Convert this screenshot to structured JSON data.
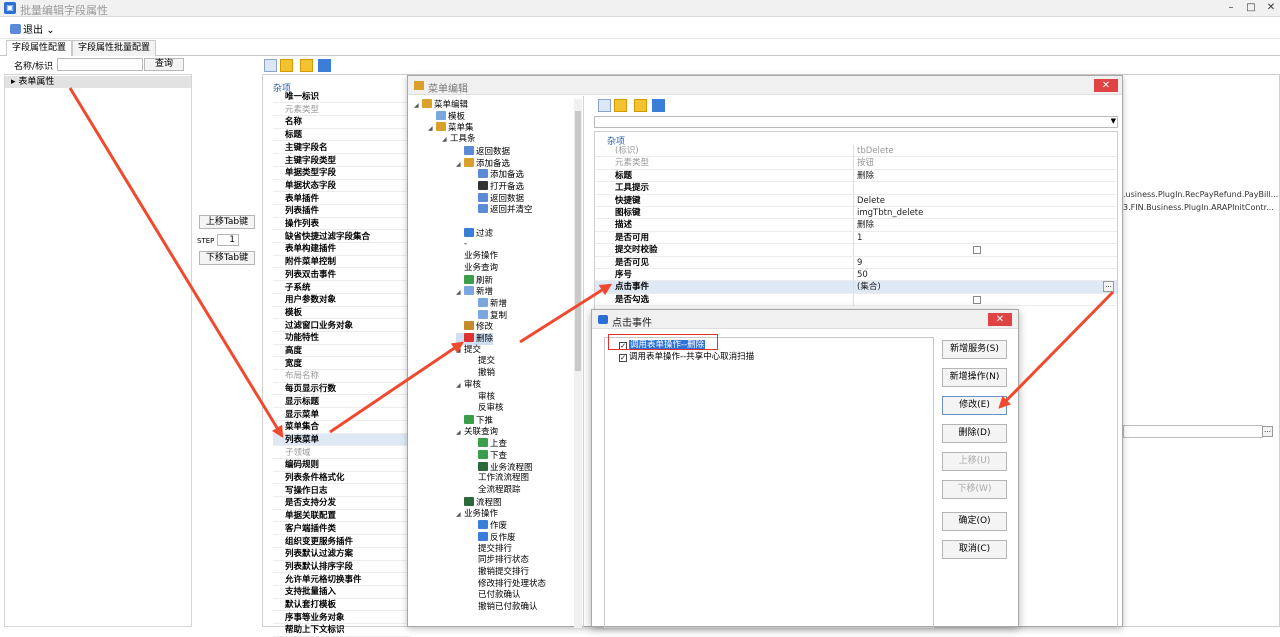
{
  "window": {
    "title": "批量编辑字段属性",
    "min": "–",
    "max": "□",
    "close": "✕"
  },
  "toolbar": {
    "exit": "退出",
    "dropdown": "⌄"
  },
  "tabs": [
    "字段属性配置",
    "字段属性批量配置"
  ],
  "search": {
    "label": "名称/标识",
    "value": "",
    "button": "查询"
  },
  "left_tree": {
    "root": "表单属性"
  },
  "mid_controls": {
    "up": "上移Tab键",
    "step_label": "STEP",
    "step_value": "1",
    "down": "下移Tab键"
  },
  "props": {
    "category": "杂项",
    "rows": [
      {
        "label": "唯一标识",
        "gray": false
      },
      {
        "label": "元素类型",
        "gray": true
      },
      {
        "label": "名称",
        "gray": false
      },
      {
        "label": "标题",
        "gray": false
      },
      {
        "label": "主键字段名",
        "gray": false
      },
      {
        "label": "主键字段类型",
        "gray": false
      },
      {
        "label": "单据类型字段",
        "gray": false
      },
      {
        "label": "单据状态字段",
        "gray": false
      },
      {
        "label": "表单插件",
        "gray": false
      },
      {
        "label": "列表插件",
        "gray": false
      },
      {
        "label": "操作列表",
        "gray": false
      },
      {
        "label": "缺省快捷过滤字段集合",
        "gray": false
      },
      {
        "label": "表单构建插件",
        "gray": false
      },
      {
        "label": "附件菜单控制",
        "gray": false
      },
      {
        "label": "列表双击事件",
        "gray": false
      },
      {
        "label": "子系统",
        "gray": false
      },
      {
        "label": "用户参数对象",
        "gray": false
      },
      {
        "label": "模板",
        "gray": false
      },
      {
        "label": "过滤窗口业务对象",
        "gray": false
      },
      {
        "label": "功能特性",
        "gray": false
      },
      {
        "label": "高度",
        "gray": false
      },
      {
        "label": "宽度",
        "gray": false
      },
      {
        "label": "布局名称",
        "gray": true
      },
      {
        "label": "每页显示行数",
        "gray": false
      },
      {
        "label": "显示标题",
        "gray": false
      },
      {
        "label": "显示菜单",
        "gray": false
      },
      {
        "label": "菜单集合",
        "gray": false
      },
      {
        "label": "列表菜单",
        "gray": false,
        "sel": true
      },
      {
        "label": "子领域",
        "gray": true
      },
      {
        "label": "编码规则",
        "gray": false
      },
      {
        "label": "列表条件格式化",
        "gray": false
      },
      {
        "label": "写操作日志",
        "gray": false
      },
      {
        "label": "是否支持分发",
        "gray": false
      },
      {
        "label": "单据关联配置",
        "gray": false
      },
      {
        "label": "客户端插件类",
        "gray": false
      },
      {
        "label": "组织变更服务插件",
        "gray": false
      },
      {
        "label": "列表默认过滤方案",
        "gray": false
      },
      {
        "label": "列表默认排序字段",
        "gray": false
      },
      {
        "label": "允许单元格切换事件",
        "gray": false
      },
      {
        "label": "支持批量插入",
        "gray": false
      },
      {
        "label": "默认套打模板",
        "gray": false
      },
      {
        "label": "序事等业务对象",
        "gray": false
      },
      {
        "label": "帮助上下文标识",
        "gray": false
      }
    ],
    "far_values": [
      ".usiness.PlugIn.RecPayRefund.PayBill...",
      "3.FIN.Business.PlugIn.ARAPInitContr..."
    ]
  },
  "menu_editor": {
    "title": "菜单编辑",
    "close": "✕",
    "tree": [
      {
        "text": "菜单编辑",
        "lvl": 0,
        "tri": "◢",
        "ic": "#d9a02a"
      },
      {
        "text": "模板",
        "lvl": 1,
        "tri": "",
        "ic": "#7aa7e0"
      },
      {
        "text": "菜单集",
        "lvl": 1,
        "tri": "◢",
        "ic": "#d9a02a"
      },
      {
        "text": "工具条",
        "lvl": 2,
        "tri": "◢",
        "ic": ""
      },
      {
        "text": "返回数据",
        "lvl": 3,
        "tri": "",
        "ic": "#5b8bd6"
      },
      {
        "text": "添加备选",
        "lvl": 3,
        "tri": "◢",
        "ic": "#d9a02a"
      },
      {
        "text": "添加备选",
        "lvl": 4,
        "tri": "",
        "ic": "#5b8bd6"
      },
      {
        "text": "打开备选",
        "lvl": 4,
        "tri": "",
        "ic": "#333333"
      },
      {
        "text": "返回数据",
        "lvl": 4,
        "tri": "",
        "ic": "#5b8bd6"
      },
      {
        "text": "返回并清空",
        "lvl": 4,
        "tri": "",
        "ic": "#5b8bd6"
      },
      {
        "text": "",
        "lvl": 3,
        "tri": "",
        "ic": ""
      },
      {
        "text": "过滤",
        "lvl": 3,
        "tri": "",
        "ic": "#3a7ed8"
      },
      {
        "text": "-",
        "lvl": 3,
        "tri": "",
        "ic": ""
      },
      {
        "text": "业务操作",
        "lvl": 3,
        "tri": "",
        "ic": ""
      },
      {
        "text": "业务查询",
        "lvl": 3,
        "tri": "",
        "ic": ""
      },
      {
        "text": "刷新",
        "lvl": 3,
        "tri": "",
        "ic": "#3a9e4a"
      },
      {
        "text": "新增",
        "lvl": 3,
        "tri": "◢",
        "ic": "#7aa7e0"
      },
      {
        "text": "新增",
        "lvl": 4,
        "tri": "",
        "ic": "#7aa7e0"
      },
      {
        "text": "复制",
        "lvl": 4,
        "tri": "",
        "ic": "#7aa7e0"
      },
      {
        "text": "修改",
        "lvl": 3,
        "tri": "",
        "ic": "#c58a2a"
      },
      {
        "text": "删除",
        "lvl": 3,
        "tri": "",
        "ic": "#e03030",
        "sel": true
      },
      {
        "text": "提交",
        "lvl": 3,
        "tri": "◢",
        "ic": ""
      },
      {
        "text": "提交",
        "lvl": 4,
        "tri": "",
        "ic": ""
      },
      {
        "text": "撤销",
        "lvl": 4,
        "tri": "",
        "ic": ""
      },
      {
        "text": "审核",
        "lvl": 3,
        "tri": "◢",
        "ic": ""
      },
      {
        "text": "审核",
        "lvl": 4,
        "tri": "",
        "ic": ""
      },
      {
        "text": "反审核",
        "lvl": 4,
        "tri": "",
        "ic": ""
      },
      {
        "text": "下推",
        "lvl": 3,
        "tri": "",
        "ic": "#3a9e4a"
      },
      {
        "text": "关联查询",
        "lvl": 3,
        "tri": "◢",
        "ic": ""
      },
      {
        "text": "上查",
        "lvl": 4,
        "tri": "",
        "ic": "#3a9e4a"
      },
      {
        "text": "下查",
        "lvl": 4,
        "tri": "",
        "ic": "#3a9e4a"
      },
      {
        "text": "业务流程图",
        "lvl": 4,
        "tri": "",
        "ic": "#2a6a3a"
      },
      {
        "text": "工作流流程图",
        "lvl": 4,
        "tri": "",
        "ic": ""
      },
      {
        "text": "全流程跟踪",
        "lvl": 4,
        "tri": "",
        "ic": ""
      },
      {
        "text": "流程图",
        "lvl": 3,
        "tri": "",
        "ic": "#2a6a3a"
      },
      {
        "text": "业务操作",
        "lvl": 3,
        "tri": "◢",
        "ic": ""
      },
      {
        "text": "作废",
        "lvl": 4,
        "tri": "",
        "ic": "#3a7ed8"
      },
      {
        "text": "反作废",
        "lvl": 4,
        "tri": "",
        "ic": "#3a7ed8"
      },
      {
        "text": "提交排行",
        "lvl": 4,
        "tri": "",
        "ic": ""
      },
      {
        "text": "同步排行状态",
        "lvl": 4,
        "tri": "",
        "ic": ""
      },
      {
        "text": "撤销提交排行",
        "lvl": 4,
        "tri": "",
        "ic": ""
      },
      {
        "text": "修改排行处理状态",
        "lvl": 4,
        "tri": "",
        "ic": ""
      },
      {
        "text": "已付款确认",
        "lvl": 4,
        "tri": "",
        "ic": ""
      },
      {
        "text": "撤销已付款确认",
        "lvl": 4,
        "tri": "",
        "ic": ""
      }
    ],
    "grid": {
      "category": "杂项",
      "rows": [
        {
          "k": "(标识)",
          "v": "tbDelete",
          "gray": true
        },
        {
          "k": "元素类型",
          "v": "按钮",
          "gray": true
        },
        {
          "k": "标题",
          "v": "删除"
        },
        {
          "k": "工具提示",
          "v": ""
        },
        {
          "k": "快捷键",
          "v": "Delete"
        },
        {
          "k": "图标键",
          "v": "imgTbtn_delete"
        },
        {
          "k": "描述",
          "v": "删除"
        },
        {
          "k": "是否可用",
          "v": "1"
        },
        {
          "k": "提交时校验",
          "v": "",
          "cb": true
        },
        {
          "k": "是否可见",
          "v": "9"
        },
        {
          "k": "序号",
          "v": "50"
        },
        {
          "k": "点击事件",
          "v": "(集合)",
          "sel": true,
          "dots": true
        },
        {
          "k": "是否勾选",
          "v": "",
          "cb": true
        }
      ],
      "dots": "..."
    }
  },
  "click_dialog": {
    "title": "点击事件",
    "close": "✕",
    "events": [
      {
        "text": "调用表单操作--删除",
        "sel": true
      },
      {
        "text": "调用表单操作--共享中心取消扫描",
        "sel": false
      }
    ],
    "check": "✓",
    "buttons": [
      {
        "label": "新增服务(S)",
        "state": "normal"
      },
      {
        "label": "新增操作(N)",
        "state": "normal"
      },
      {
        "label": "修改(E)",
        "state": "focus"
      },
      {
        "label": "删除(D)",
        "state": "normal"
      },
      {
        "label": "上移(U)",
        "state": "dis"
      },
      {
        "label": "下移(W)",
        "state": "dis"
      },
      {
        "label": "确定(O)",
        "state": "normal"
      },
      {
        "label": "取消(C)",
        "state": "normal"
      }
    ]
  },
  "colors": {
    "accent": "#2f73d8",
    "arrow": "#ef4a2f",
    "close": "#e04343",
    "highlight_box": "#e03030"
  }
}
